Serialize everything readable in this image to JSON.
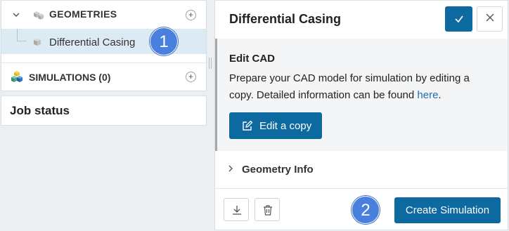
{
  "tree": {
    "geometries": {
      "label": "GEOMETRIES",
      "icon": "cube-stack-icon"
    },
    "geometry_item": {
      "label": "Differential Casing",
      "icon": "cube-icon"
    },
    "simulations": {
      "label": "SIMULATIONS (0)",
      "icon": "colored-cubes-icon"
    },
    "badge_1": "1"
  },
  "job_status": {
    "label": "Job status"
  },
  "detail": {
    "title": "Differential Casing",
    "edit_cad": {
      "heading": "Edit CAD",
      "description": "Prepare your CAD model for simulation by editing a copy. Detailed information can be found ",
      "link_text": "here",
      "description_end": ".",
      "button_label": "Edit a copy"
    },
    "geometry_info": {
      "label": "Geometry Info"
    },
    "footer": {
      "badge_2": "2",
      "create_label": "Create Simulation"
    }
  },
  "colors": {
    "primary": "#0d6aa0",
    "selection": "#dceaf4",
    "badge": "#4a7fde",
    "link": "#1f6fb5"
  }
}
